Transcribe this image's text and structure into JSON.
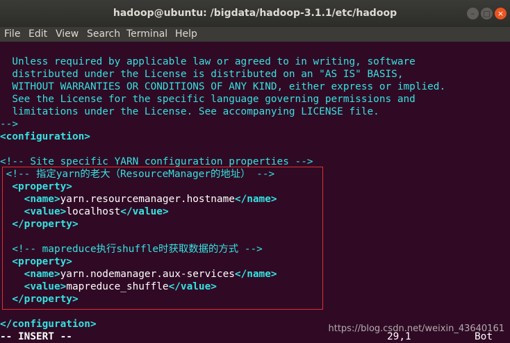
{
  "window": {
    "title": "hadoop@ubuntu: /bigdata/hadoop-3.1.1/etc/hadoop",
    "minimize_glyph": "–",
    "maximize_glyph": "□",
    "close_glyph": "×"
  },
  "menu": [
    "File",
    "Edit",
    "View",
    "Search",
    "Terminal",
    "Help"
  ],
  "lines": [
    {
      "t": "  Unless required by applicable law or agreed to in writing, software",
      "c": "c-cyan"
    },
    {
      "t": "  distributed under the License is distributed on an \"AS IS\" BASIS,",
      "c": "c-cyan"
    },
    {
      "t": "  WITHOUT WARRANTIES OR CONDITIONS OF ANY KIND, either express or implied.",
      "c": "c-cyan"
    },
    {
      "t": "  See the License for the specific language governing permissions and",
      "c": "c-cyan"
    },
    {
      "t": "  limitations under the License. See accompanying LICENSE file.",
      "c": "c-cyan"
    },
    {
      "t": "-->",
      "c": "c-cyan"
    },
    {
      "t": "<configuration>",
      "c": "c-tag"
    },
    {
      "t": "",
      "c": "c-cyan"
    },
    {
      "t": "<!-- Site specific YARN configuration properties -->",
      "c": "c-comment"
    },
    {
      "t": " <!-- 指定yarn的老大（ResourceManager的地址） -->",
      "c": "c-comment"
    },
    {
      "t": "  <property>",
      "c": "c-tag"
    },
    {
      "t": "    <name>yarn.resourcemanager.hostname</name>",
      "c": "mixed"
    },
    {
      "t": "    <value>localhost</value>",
      "c": "mixed"
    },
    {
      "t": "  </property>",
      "c": "c-tag"
    },
    {
      "t": "",
      "c": "c-cyan"
    },
    {
      "t": "  <!-- mapreduce执行shuffle时获取数据的方式 -->",
      "c": "c-comment"
    },
    {
      "t": "  <property>",
      "c": "c-tag"
    },
    {
      "t": "    <name>yarn.nodemanager.aux-services</name>",
      "c": "mixed"
    },
    {
      "t": "    <value>mapreduce_shuffle</value>",
      "c": "mixed"
    },
    {
      "t": "  </property>",
      "c": "c-tag"
    },
    {
      "t": "",
      "c": "c-cyan"
    },
    {
      "t": "</configuration>",
      "c": "c-tag"
    }
  ],
  "status": {
    "mode": "-- INSERT --",
    "position": "29,1",
    "percent": "Bot"
  },
  "watermark": "https://blog.csdn.net/weixin_43640161"
}
